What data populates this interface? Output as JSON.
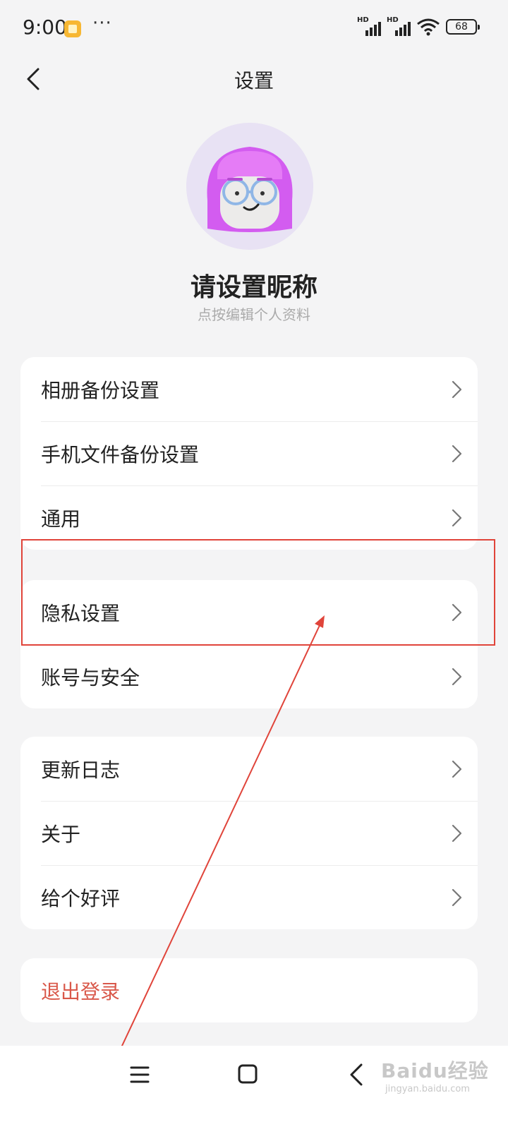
{
  "status_bar": {
    "time": "9:00",
    "more": "···",
    "battery": "68",
    "signal_label": "HD"
  },
  "header": {
    "title": "设置"
  },
  "profile": {
    "nickname": "请设置昵称",
    "hint": "点按编辑个人资料"
  },
  "groups": [
    {
      "items": [
        "相册备份设置",
        "手机文件备份设置",
        "通用"
      ]
    },
    {
      "items": [
        "隐私设置",
        "账号与安全"
      ]
    },
    {
      "items": [
        "更新日志",
        "关于",
        "给个好评"
      ]
    }
  ],
  "logout": {
    "label": "退出登录"
  },
  "watermark": {
    "text": "Baidu经验",
    "sub": "jingyan.baidu.com"
  },
  "colors": {
    "accent_red": "#d9584a",
    "annotation": "#e0443a",
    "background": "#f4f4f5"
  }
}
